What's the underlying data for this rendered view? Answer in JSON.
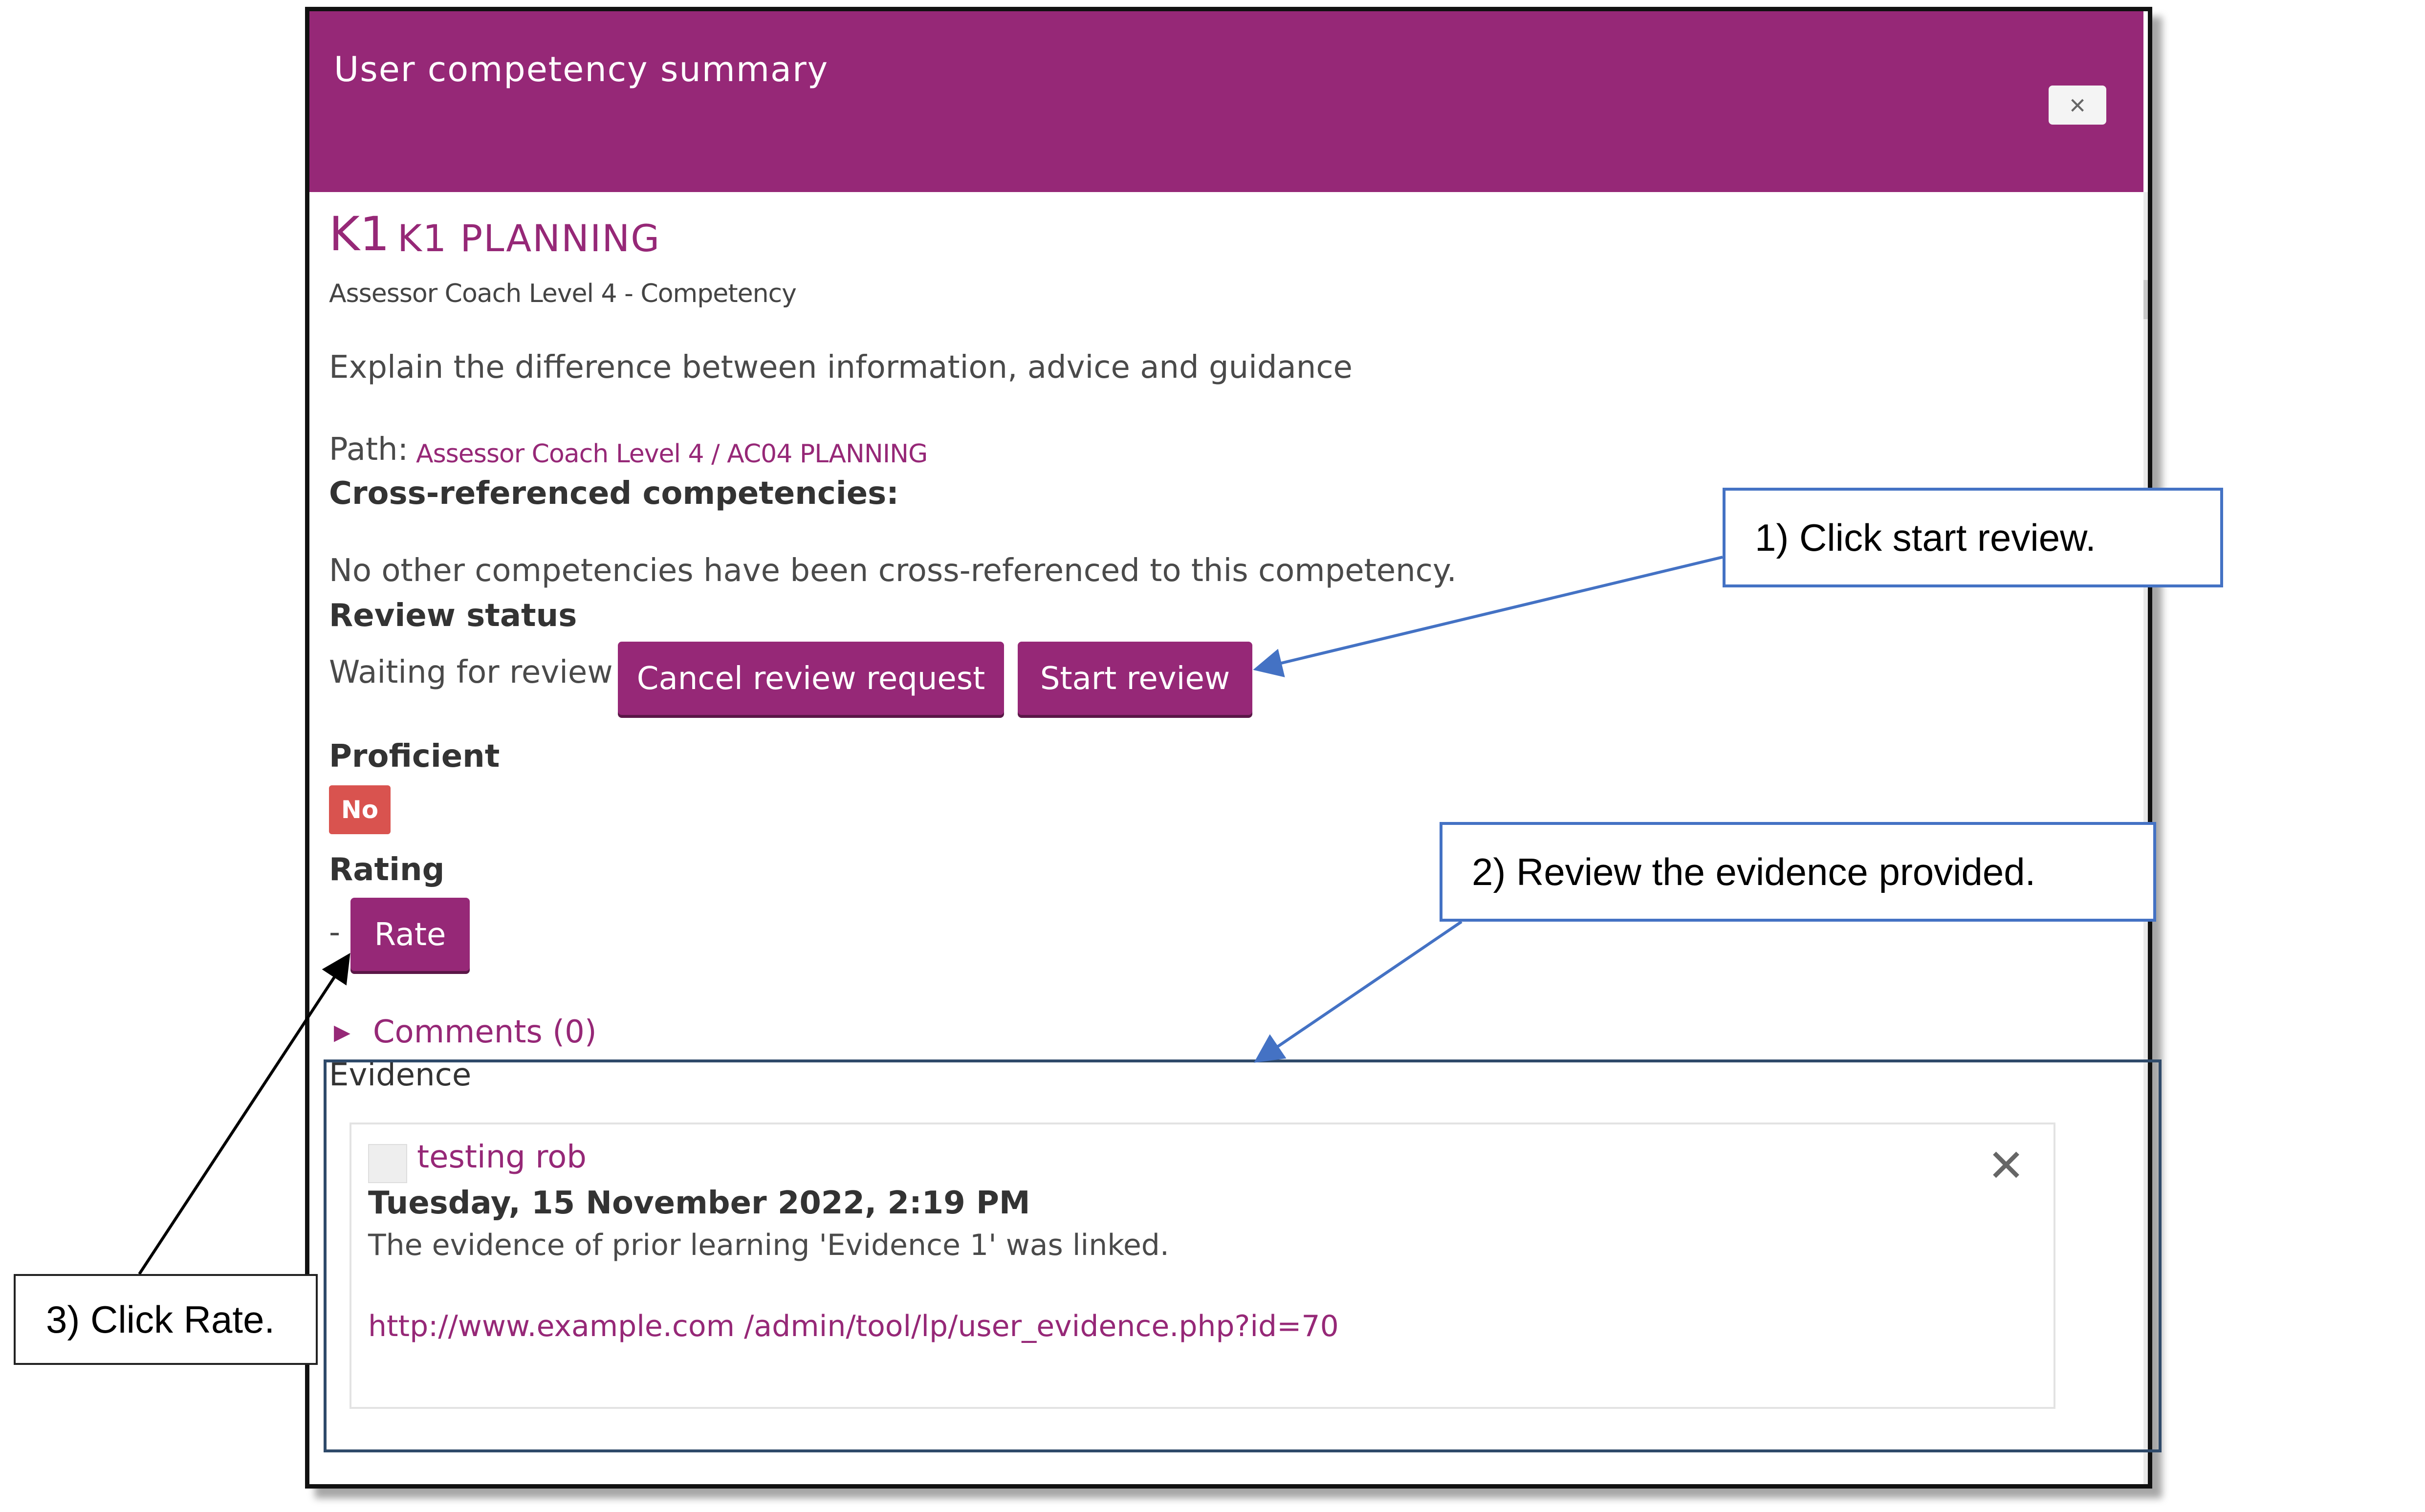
{
  "dialog": {
    "title": "User competency summary",
    "close_label": "×"
  },
  "competency": {
    "id": "K1",
    "name": "K1 PLANNING",
    "framework": "Assessor Coach Level 4 - Competency",
    "description": "Explain the difference between information, advice and guidance",
    "path_label": "Path:",
    "path_link": "Assessor Coach Level 4 / AC04 PLANNING"
  },
  "cross_referenced": {
    "heading": "Cross-referenced competencies:",
    "text": "No other competencies have been cross-referenced to this competency."
  },
  "review": {
    "heading": "Review status",
    "status": "Waiting for review",
    "cancel_button": "Cancel review request",
    "start_button": "Start review"
  },
  "proficient": {
    "heading": "Proficient",
    "value": "No",
    "color": "#d9534f"
  },
  "rating": {
    "heading": "Rating",
    "value": "-",
    "rate_button": "Rate"
  },
  "comments": {
    "label": "Comments (0)"
  },
  "evidence": {
    "heading": "Evidence",
    "items": [
      {
        "user": "testing rob",
        "date": "Tuesday, 15 November 2022, 2:19 PM",
        "text": "The evidence of prior learning 'Evidence 1' was linked.",
        "link": "http://www.example.com /admin/tool/lp/user_evidence.php?id=70",
        "remove_label": "✕"
      }
    ]
  },
  "annotations": {
    "step1": "1) Click start review.",
    "step2": "2) Review the evidence provided.",
    "step3": "3) Click Rate."
  },
  "colors": {
    "brand": "#962877",
    "callout_border": "#4472c4"
  }
}
